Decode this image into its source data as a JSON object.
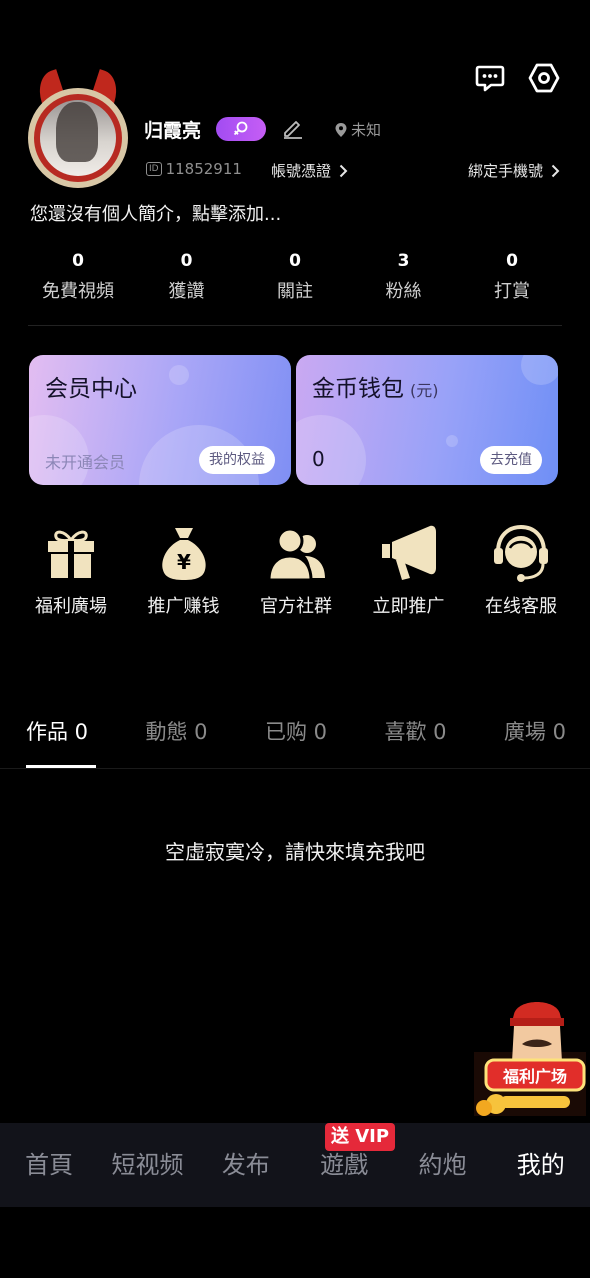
{
  "profile": {
    "username": "归霞亮",
    "location": "未知",
    "id_tag": "ID",
    "user_id": "11852911",
    "cert_label": "帳號憑證",
    "bind_phone_label": "綁定手機號",
    "bio": "您還沒有個人簡介，點擊添加..."
  },
  "stats": [
    {
      "value": "0",
      "label": "免費視頻"
    },
    {
      "value": "0",
      "label": "獲讚"
    },
    {
      "value": "0",
      "label": "關註"
    },
    {
      "value": "3",
      "label": "粉絲"
    },
    {
      "value": "0",
      "label": "打賞"
    }
  ],
  "cards": {
    "vip": {
      "title": "会员中心",
      "status": "未开通会员",
      "button": "我的权益"
    },
    "wallet": {
      "title": "金币钱包",
      "unit": "(元)",
      "amount": "0",
      "button": "去充值"
    }
  },
  "shortcuts": [
    {
      "label": "福利廣場",
      "icon": "gift-icon"
    },
    {
      "label": "推广赚钱",
      "icon": "money-bag-icon"
    },
    {
      "label": "官方社群",
      "icon": "group-icon"
    },
    {
      "label": "立即推广",
      "icon": "megaphone-icon"
    },
    {
      "label": "在线客服",
      "icon": "headset-icon"
    }
  ],
  "tabs": [
    {
      "label": "作品 0"
    },
    {
      "label": "動態 0"
    },
    {
      "label": "已购 0"
    },
    {
      "label": "喜歡 0"
    },
    {
      "label": "廣場 0"
    }
  ],
  "empty_text": "空虛寂寞冷，請快來填充我吧",
  "promo_label": "福利广场",
  "bottom_nav": [
    {
      "label": "首頁"
    },
    {
      "label": "短视频"
    },
    {
      "label": "发布"
    },
    {
      "label": "遊戲",
      "badge": "送 VIP"
    },
    {
      "label": "約炮"
    },
    {
      "label": "我的"
    }
  ],
  "colors": {
    "accent_purple": "#b055f4",
    "badge_red": "#e5293a",
    "shortcut_gold": "#f1e3bf"
  }
}
